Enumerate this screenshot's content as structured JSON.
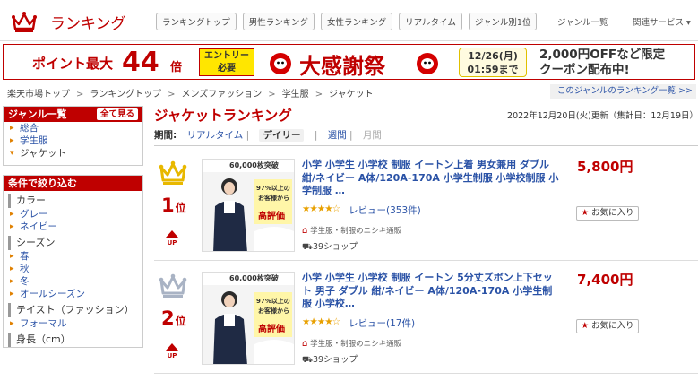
{
  "header": {
    "site_title": "ランキング",
    "nav": [
      "ランキングトップ",
      "男性ランキング",
      "女性ランキング",
      "リアルタイム",
      "ジャンル別1位"
    ],
    "genre_list": "ジャンル一覧",
    "related": "関連サービス ▾"
  },
  "banner": {
    "point": "ポイント最大",
    "multiplier": "44",
    "bai": "倍",
    "entry_line1": "エントリー",
    "entry_line2": "必要",
    "title": "大感謝祭",
    "date_line1": "12/26(月)",
    "date_line2": "01:59まで",
    "promo_line1": "2,000円OFFなど限定",
    "promo_line2": "クーポン配布中!"
  },
  "breadcrumb": [
    "楽天市場トップ",
    "ランキングトップ",
    "メンズファッション",
    "学生服",
    "ジャケット"
  ],
  "genre_ranking_link": "このジャンルのランキング一覧 >>",
  "sidebar": {
    "genre_heading": "ジャンル一覧",
    "all_view": "全て見る",
    "genres": [
      "総合",
      "学生服",
      "ジャケット"
    ],
    "filter_heading": "条件で絞り込む",
    "groups": [
      {
        "title": "カラー",
        "items": [
          "グレー",
          "ネイビー"
        ]
      },
      {
        "title": "シーズン",
        "items": [
          "春",
          "秋",
          "冬",
          "オールシーズン"
        ]
      },
      {
        "title": "テイスト（ファッション）",
        "items": [
          "フォーマル"
        ]
      },
      {
        "title": "身長（cm）",
        "items": []
      }
    ]
  },
  "main": {
    "title": "ジャケットランキング",
    "update": "2022年12月20日(火)更新（集計日：12月19日）",
    "period_label": "期間:",
    "periods": [
      "リアルタイム",
      "デイリー",
      "週間",
      "月間"
    ]
  },
  "items": [
    {
      "rank": "1",
      "rank_suffix": "位",
      "up": "UP",
      "title": "小学 小学生 小学校 制服 イートン上着 男女兼用 ダブル紺/ネイビー A体/120A-170A 小学生制服 小学校制服 小学制服 …",
      "stars": "★★★★☆",
      "review": "レビュー(353件)",
      "shop": "学生服・制服のニシキ通販",
      "shop_count": "39ショップ",
      "price": "5,800円",
      "fav": "お気に入り",
      "thumb_top": "60,000枚突破",
      "thumb_pct": "97%以上の",
      "thumb_mid": "お客様から",
      "thumb_high": "高評価",
      "crown_color": "#e8b800"
    },
    {
      "rank": "2",
      "rank_suffix": "位",
      "up": "UP",
      "title": "小学 小学生 小学校 制服 イートン 5分丈ズボン上下セット 男子 ダブル 紺/ネイビー A体/120A-170A 小学生制服 小学校…",
      "stars": "★★★★☆",
      "review": "レビュー(17件)",
      "shop": "学生服・制服のニシキ通販",
      "shop_count": "39ショップ",
      "price": "7,400円",
      "fav": "お気に入り",
      "thumb_top": "60,000枚突破",
      "thumb_pct": "97%以上の",
      "thumb_mid": "お客様から",
      "thumb_high": "高評価",
      "crown_color": "#a9b3c4"
    }
  ]
}
